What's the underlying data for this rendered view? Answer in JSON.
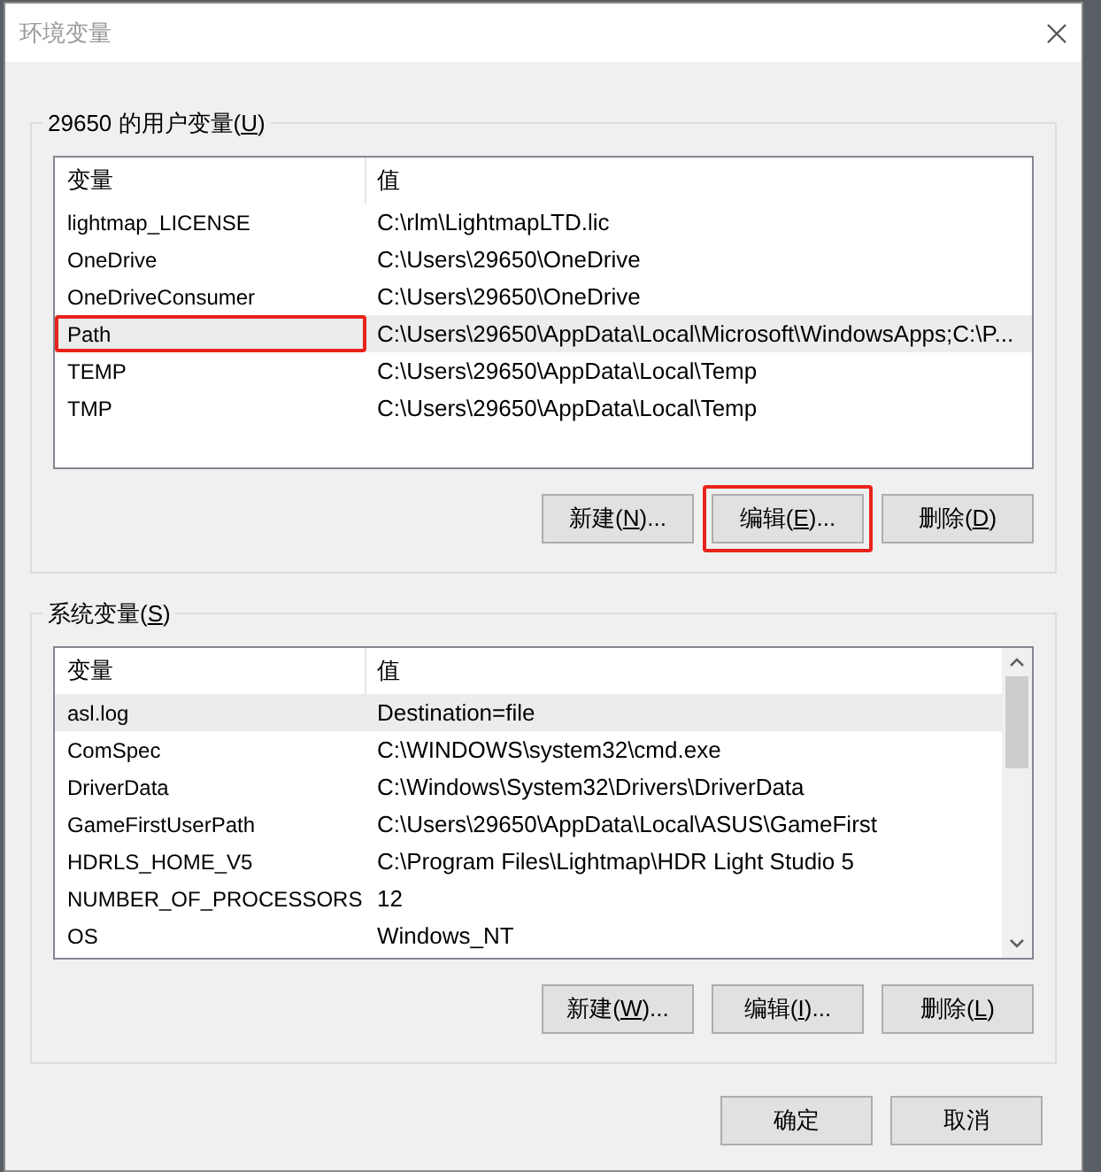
{
  "window": {
    "title": "环境变量"
  },
  "user_vars": {
    "title": {
      "before": "29650 的用户变量(",
      "key": "U",
      "after": ")"
    },
    "columns": [
      "变量",
      "值"
    ],
    "rows": [
      {
        "name": "lightmap_LICENSE",
        "value": "C:\\rlm\\LightmapLTD.lic",
        "selected": false,
        "annotated": false
      },
      {
        "name": "OneDrive",
        "value": "C:\\Users\\29650\\OneDrive",
        "selected": false,
        "annotated": false
      },
      {
        "name": "OneDriveConsumer",
        "value": "C:\\Users\\29650\\OneDrive",
        "selected": false,
        "annotated": false
      },
      {
        "name": "Path",
        "value": "C:\\Users\\29650\\AppData\\Local\\Microsoft\\WindowsApps;C:\\P...",
        "selected": true,
        "annotated": true
      },
      {
        "name": "TEMP",
        "value": "C:\\Users\\29650\\AppData\\Local\\Temp",
        "selected": false,
        "annotated": false
      },
      {
        "name": "TMP",
        "value": "C:\\Users\\29650\\AppData\\Local\\Temp",
        "selected": false,
        "annotated": false
      }
    ],
    "buttons": [
      {
        "before": "新建(",
        "key": "N",
        "after": ")...",
        "annotated": false
      },
      {
        "before": "编辑(",
        "key": "E",
        "after": ")...",
        "annotated": true
      },
      {
        "before": "删除(",
        "key": "D",
        "after": ")",
        "annotated": false
      }
    ]
  },
  "system_vars": {
    "title": {
      "before": "系统变量(",
      "key": "S",
      "after": ")"
    },
    "columns": [
      "变量",
      "值"
    ],
    "rows": [
      {
        "name": "asl.log",
        "value": "Destination=file",
        "selected": true,
        "annotated": false
      },
      {
        "name": "ComSpec",
        "value": "C:\\WINDOWS\\system32\\cmd.exe",
        "selected": false,
        "annotated": false
      },
      {
        "name": "DriverData",
        "value": "C:\\Windows\\System32\\Drivers\\DriverData",
        "selected": false,
        "annotated": false
      },
      {
        "name": "GameFirstUserPath",
        "value": "C:\\Users\\29650\\AppData\\Local\\ASUS\\GameFirst",
        "selected": false,
        "annotated": false
      },
      {
        "name": "HDRLS_HOME_V5",
        "value": "C:\\Program Files\\Lightmap\\HDR Light Studio 5",
        "selected": false,
        "annotated": false
      },
      {
        "name": "NUMBER_OF_PROCESSORS",
        "value": "12",
        "selected": false,
        "annotated": false
      },
      {
        "name": "OS",
        "value": "Windows_NT",
        "selected": false,
        "annotated": false
      }
    ],
    "buttons": [
      {
        "before": "新建(",
        "key": "W",
        "after": ")...",
        "annotated": false
      },
      {
        "before": "编辑(",
        "key": "I",
        "after": ")...",
        "annotated": false
      },
      {
        "before": "删除(",
        "key": "L",
        "after": ")",
        "annotated": false
      }
    ]
  },
  "footer_buttons": [
    {
      "label": "确定"
    },
    {
      "label": "取消"
    }
  ]
}
